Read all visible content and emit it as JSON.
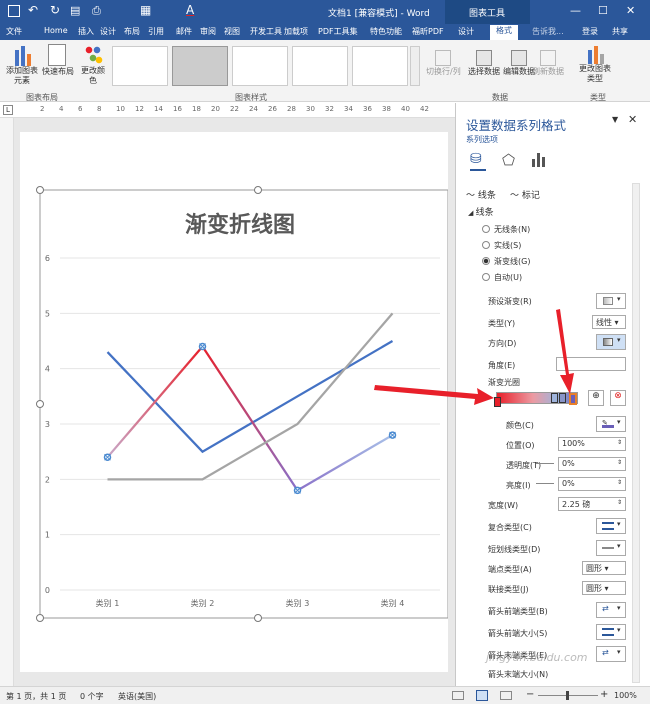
{
  "titlebar": {
    "title": "文档1 [兼容模式] - Word",
    "tools_label": "图表工具",
    "search_placeholder": "告诉我...",
    "login": "登录",
    "share": "共享"
  },
  "menu_tabs": [
    "文件",
    "Home",
    "插入",
    "设计",
    "布局",
    "引用",
    "邮件",
    "审阅",
    "视图",
    "开发工具",
    "加载项",
    "PDF工具集",
    "特色功能",
    "福昕PDF",
    "设计",
    "格式"
  ],
  "ribbon": {
    "add_element": "添加图表元素",
    "quick_layout": "快速布局",
    "change_colors": "更改颜色",
    "group_layout": "图表布局",
    "group_styles": "图表样式",
    "switch_rowcol": "切换行/列",
    "select_data": "选择数据",
    "edit_data": "编辑数据",
    "refresh_data": "刷新数据",
    "group_data": "数据",
    "change_type": "更改图表类型",
    "group_type": "类型"
  },
  "ruler_ticks": [
    "2",
    "4",
    "6",
    "8",
    "10",
    "12",
    "14",
    "16",
    "18",
    "20",
    "22",
    "24",
    "26",
    "28",
    "30",
    "32",
    "34",
    "36",
    "38",
    "40",
    "42"
  ],
  "chart_data": {
    "type": "line",
    "title": "渐变折线图",
    "categories": [
      "类别 1",
      "类别 2",
      "类别 3",
      "类别 4"
    ],
    "ylim": [
      0,
      6
    ],
    "yticks": [
      "0",
      "1",
      "2",
      "3",
      "4",
      "5",
      "6"
    ],
    "series": [
      {
        "values": [
          4.3,
          2.5,
          3.5,
          4.5
        ],
        "color": "#4472c4"
      },
      {
        "values": [
          2.4,
          4.4,
          1.8,
          2.8
        ],
        "color": "#e0303c"
      },
      {
        "values": [
          2.0,
          2.0,
          3.0,
          5.0
        ],
        "color": "#a5a5a5"
      }
    ]
  },
  "pane": {
    "title": "设置数据系列格式",
    "subtitle": "系列选项",
    "tab_line": "线条",
    "tab_marker": "标记",
    "section": "线条",
    "radio_none": "无线条(N)",
    "radio_solid": "实线(S)",
    "radio_gradient": "渐变线(G)",
    "radio_auto": "自动(U)",
    "preset": "预设渐变(R)",
    "type_label": "类型(Y)",
    "type_value": "线性",
    "direction": "方向(D)",
    "angle": "角度(E)",
    "stops": "渐变光圈",
    "color": "颜色(C)",
    "position": "位置(O)",
    "position_value": "100%",
    "transparency": "透明度(T)",
    "transparency_value": "0%",
    "brightness": "亮度(I)",
    "brightness_value": "0%",
    "width": "宽度(W)",
    "width_value": "2.25 磅",
    "compound": "复合类型(C)",
    "dash": "短划线类型(D)",
    "cap": "端点类型(A)",
    "cap_value": "圆形",
    "join": "联接类型(J)",
    "join_value": "圆形",
    "arrow_begin_type": "箭头前端类型(B)",
    "arrow_begin_size": "箭头前端大小(S)",
    "arrow_end_type": "箭头末端类型(E)",
    "arrow_end_size": "箭头末端大小(N)"
  },
  "status": {
    "page": "第 1 页，共 1 页",
    "words": "0 个字",
    "lang": "英语(美国)",
    "zoom": "100%"
  },
  "watermark": "jingyan.baidu.com",
  "colors": {
    "word_blue": "#2b579a",
    "accent": "#2b579a",
    "arrow_red": "#e8202a"
  }
}
